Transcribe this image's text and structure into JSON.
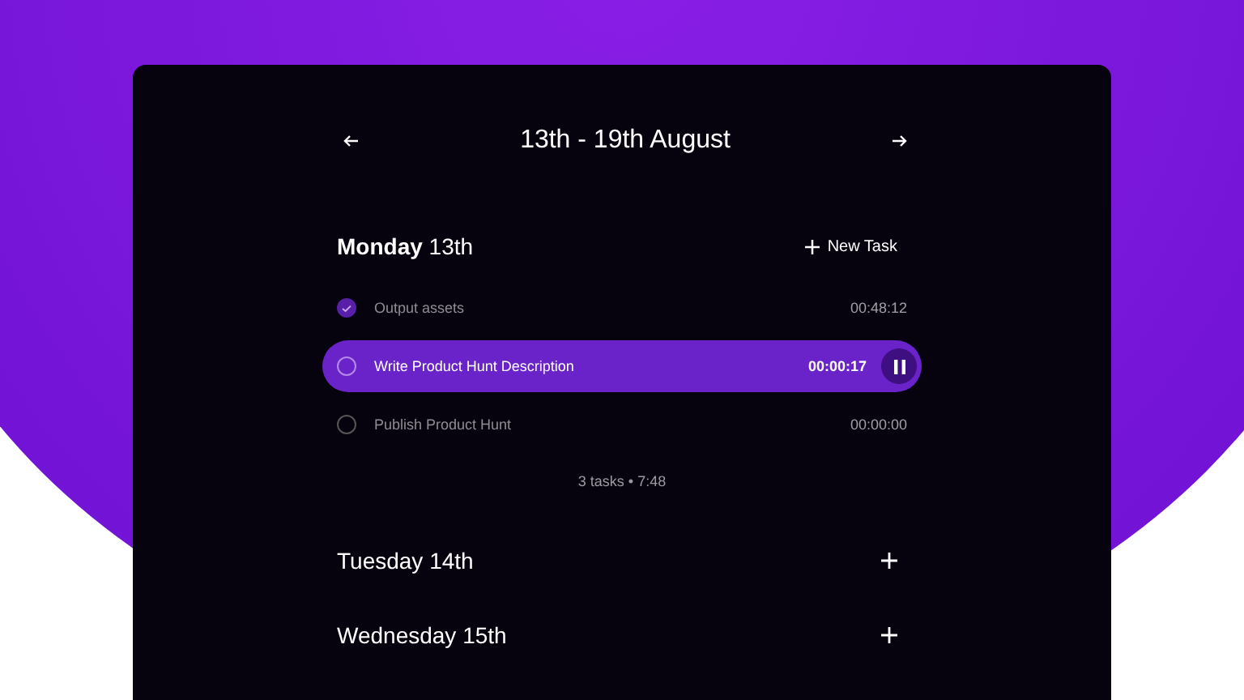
{
  "week_title": "13th - 19th August",
  "days": [
    {
      "title": "**Monday** 13th",
      "new_task_label": "New Task",
      "summary": "3 tasks • 7:48",
      "tasks": [
        {
          "name": "Output assets",
          "time": "00:48:12",
          "checked": true,
          "running": false
        },
        {
          "name": "Write Product Hunt Description",
          "time": "00:00:17",
          "checked": false,
          "running": true
        },
        {
          "name": "Publish Product Hunt",
          "time": "00:00:00",
          "checked": false,
          "running": false
        }
      ]
    },
    {
      "title": "Tuesday 14th"
    },
    {
      "title": "Wednesday 15th"
    }
  ]
}
